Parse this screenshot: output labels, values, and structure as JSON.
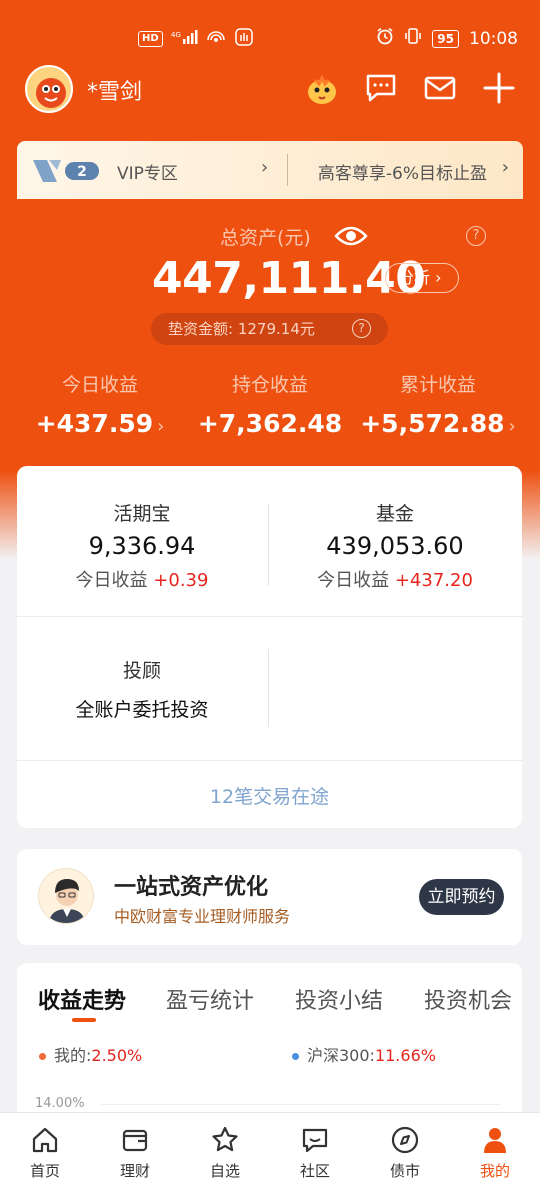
{
  "status_bar": {
    "network_badge": "HD",
    "signal": "4G",
    "battery": "95",
    "time": "10:08"
  },
  "header": {
    "username": "*雪剑"
  },
  "vip_banner": {
    "logo_text": "V2",
    "label": "VIP专区",
    "promo": "高客尊享-6%目标止盈"
  },
  "assets": {
    "total_label": "总资产(元)",
    "total_value": "447,111.40",
    "analysis_button": "分析",
    "pad_amount_label": "垫资金额:",
    "pad_amount_value": "1279.14元"
  },
  "stats": [
    {
      "label": "今日收益",
      "value": "+437.59",
      "has_chevron": true
    },
    {
      "label": "持仓收益",
      "value": "+7,362.48",
      "has_chevron": false
    },
    {
      "label": "累计收益",
      "value": "+5,572.88",
      "has_chevron": true
    }
  ],
  "holdings": {
    "cash": {
      "title": "活期宝",
      "value": "9,336.94",
      "gain_label": "今日收益",
      "gain_value": "+0.39"
    },
    "fund": {
      "title": "基金",
      "value": "439,053.60",
      "gain_label": "今日收益",
      "gain_value": "+437.20"
    },
    "advisor": {
      "title": "投顾",
      "value": "全账户委托投资"
    },
    "in_transit": "12笔交易在途"
  },
  "advisor_promo": {
    "title": "一站式资产优化",
    "subtitle": "中欧财富专业理财师服务",
    "button": "立即预约"
  },
  "trend": {
    "tabs": [
      "收益走势",
      "盈亏统计",
      "投资小结",
      "投资机会"
    ],
    "active_tab": 0,
    "legend": [
      {
        "label": "我的:",
        "value": "2.50%",
        "color": "#ee6b3a"
      },
      {
        "label": "沪深300:",
        "value": "11.66%",
        "color": "#4a90e2"
      }
    ],
    "y_top_tick": "14.00%"
  },
  "bottom_nav": {
    "items": [
      {
        "label": "首页",
        "icon": "home-icon"
      },
      {
        "label": "理财",
        "icon": "wallet-icon"
      },
      {
        "label": "自选",
        "icon": "star-icon"
      },
      {
        "label": "社区",
        "icon": "chat-icon"
      },
      {
        "label": "债市",
        "icon": "compass-icon"
      },
      {
        "label": "我的",
        "icon": "person-icon"
      }
    ],
    "active_index": 5
  },
  "colors": {
    "brand": "#ee5010",
    "gain_red": "#e5261f",
    "link_blue": "#7fa4cf",
    "dark_button": "#2e3747"
  }
}
